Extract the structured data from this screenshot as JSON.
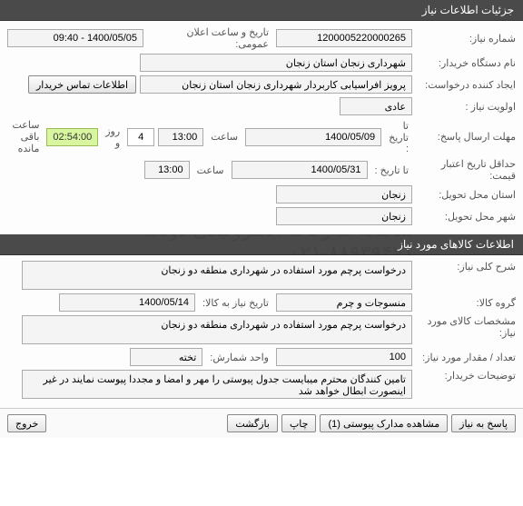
{
  "header1": "جزئیات اطلاعات نیاز",
  "need": {
    "number_label": "شماره نیاز:",
    "number": "1200005220000265",
    "announce_label": "تاریخ و ساعت اعلان عمومی:",
    "announce": "1400/05/05 - 09:40",
    "buyer_label": "نام دستگاه خریدار:",
    "buyer": "شهرداری زنجان استان زنجان",
    "creator_label": "ایجاد کننده درخواست:",
    "creator": "پرویز افراسیابی کاربردار شهرداری زنجان استان زنجان",
    "contact_btn": "اطلاعات تماس خریدار",
    "priority_label": "اولویت نیاز :",
    "priority": "عادی",
    "answer_deadline_label": "مهلت ارسال پاسخ:",
    "to_date_label": "تا تاریخ :",
    "answer_date": "1400/05/09",
    "time_label": "ساعت",
    "answer_time": "13:00",
    "days": "4",
    "days_and": "روز و",
    "remaining_time": "02:54:00",
    "remaining_label": "ساعت باقی مانده",
    "price_deadline_label": "حداقل تاریخ اعتبار قیمت:",
    "price_date": "1400/05/31",
    "price_time": "13:00",
    "delivery_province_label": "استان محل تحویل:",
    "delivery_province": "زنجان",
    "delivery_city_label": "شهر محل تحویل:",
    "delivery_city": "زنجان"
  },
  "header2": "اطلاعات کالاهای مورد نیاز",
  "goods": {
    "desc_label": "شرح کلی نیاز:",
    "desc": "درخواست پرچم مورد استفاده در شهرداری منطقه دو زنجان",
    "group_label": "گروه کالا:",
    "group": "منسوجات و چرم",
    "need_date_label": "تاریخ نیاز به کالا:",
    "need_date": "1400/05/14",
    "spec_label": "مشخصات کالای مورد نیاز:",
    "spec": "درخواست پرچم مورد استفاده در شهرداری منطقه دو زنجان",
    "qty_label": "تعداد / مقدار مورد نیاز:",
    "qty": "100",
    "unit_label": "واحد شمارش:",
    "unit": "تخته",
    "buyer_notes_label": "توضیحات خریدار:",
    "buyer_notes": "تامین کنندگان محترم میبایست جدول پیوستی را مهر و امضا و مجددا پیوست نمایند در غیر اینصورت ابطال خواهد شد"
  },
  "footer": {
    "reply": "پاسخ به نیاز",
    "attachments": "مشاهده مدارک پیوستی (1)",
    "print": "چاپ",
    "back": "بازگشت",
    "exit": "خروج"
  }
}
